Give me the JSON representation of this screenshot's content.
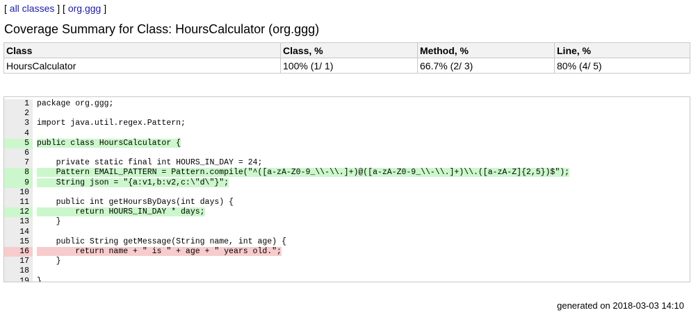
{
  "nav": {
    "open_bracket_1": "[ ",
    "all_classes": "all classes",
    "close_bracket_1": " ] [ ",
    "package": "org.ggg",
    "close_bracket_2": " ]"
  },
  "title": "Coverage Summary for Class: HoursCalculator (org.ggg)",
  "summary": {
    "headers": [
      "Class",
      "Class, %",
      "Method, %",
      "Line, %"
    ],
    "row": {
      "class_name": "HoursCalculator",
      "class_pct": "100%  (1/ 1)",
      "method_pct": "66.7%  (2/ 3)",
      "line_pct": "80%  (4/ 5)"
    }
  },
  "source": {
    "lines": [
      {
        "n": "1",
        "code": "package org.ggg;",
        "status": "none"
      },
      {
        "n": "2",
        "code": "",
        "status": "none"
      },
      {
        "n": "3",
        "code": "import java.util.regex.Pattern;",
        "status": "none"
      },
      {
        "n": "4",
        "code": "",
        "status": "none"
      },
      {
        "n": "5",
        "code": "public class HoursCalculator {",
        "status": "covered"
      },
      {
        "n": "6",
        "code": "",
        "status": "none"
      },
      {
        "n": "7",
        "code": "    private static final int HOURS_IN_DAY = 24;",
        "status": "none"
      },
      {
        "n": "8",
        "code": "    Pattern EMAIL_PATTERN = Pattern.compile(\"^([a-zA-Z0-9_\\\\-\\\\.]+)@([a-zA-Z0-9_\\\\-\\\\.]+)\\\\.([a-zA-Z]{2,5})$\");",
        "status": "covered"
      },
      {
        "n": "9",
        "code": "    String json = \"{a:v1,b:v2,c:\\\"d\\\"}\";",
        "status": "covered"
      },
      {
        "n": "10",
        "code": "",
        "status": "none"
      },
      {
        "n": "11",
        "code": "    public int getHoursByDays(int days) {",
        "status": "none"
      },
      {
        "n": "12",
        "code": "        return HOURS_IN_DAY * days;",
        "status": "covered"
      },
      {
        "n": "13",
        "code": "    }",
        "status": "none"
      },
      {
        "n": "14",
        "code": "",
        "status": "none"
      },
      {
        "n": "15",
        "code": "    public String getMessage(String name, int age) {",
        "status": "none"
      },
      {
        "n": "16",
        "code": "        return name + \" is \" + age + \" years old.\";",
        "status": "uncovered"
      },
      {
        "n": "17",
        "code": "    }",
        "status": "none"
      },
      {
        "n": "18",
        "code": "",
        "status": "none"
      },
      {
        "n": "19",
        "code": "}",
        "status": "none"
      }
    ]
  },
  "footer": "generated on 2018-03-03 14:10"
}
